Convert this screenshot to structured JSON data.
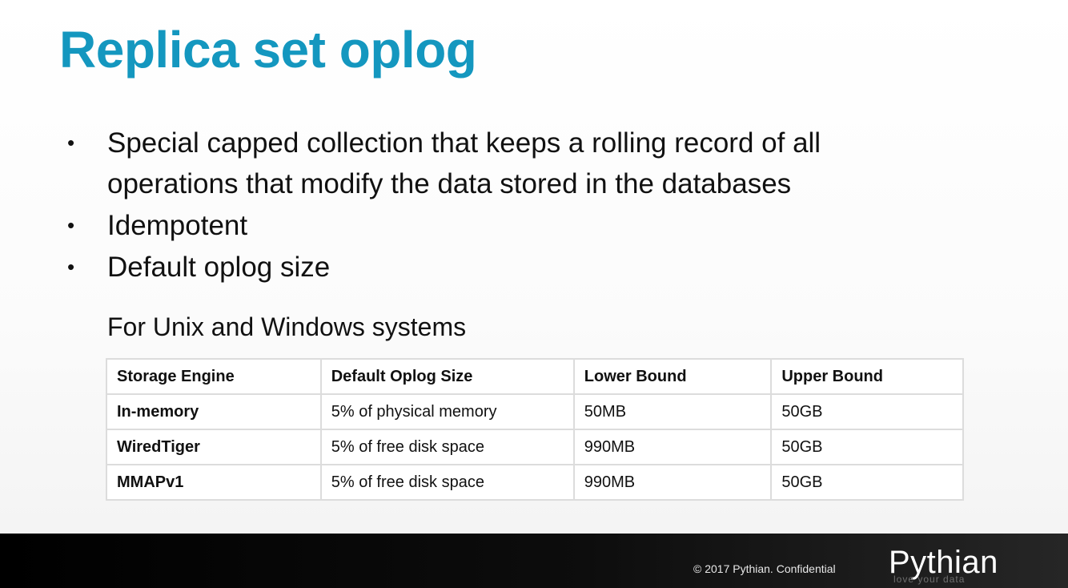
{
  "title": "Replica set oplog",
  "bullet_glyph": "•",
  "bullets": [
    "Special capped collection that keeps a rolling record of all operations that modify the data stored in the databases",
    "Idempotent",
    "Default oplog size"
  ],
  "subheading": "For Unix and Windows systems",
  "table": {
    "headers": [
      "Storage Engine",
      "Default Oplog Size",
      "Lower Bound",
      "Upper Bound"
    ],
    "rows": [
      [
        "In-memory",
        "5% of physical memory",
        "50MB",
        "50GB"
      ],
      [
        "WiredTiger",
        "5% of free disk space",
        "990MB",
        "50GB"
      ],
      [
        "MMAPv1",
        "5% of free disk space",
        "990MB",
        "50GB"
      ]
    ]
  },
  "footer": {
    "copyright": "© 2017 Pythian. Confidential",
    "logo_text": "Pythian",
    "logo_tagline": "love your data"
  },
  "colors": {
    "title": "#1497bf",
    "footer_bg": "#000000"
  }
}
